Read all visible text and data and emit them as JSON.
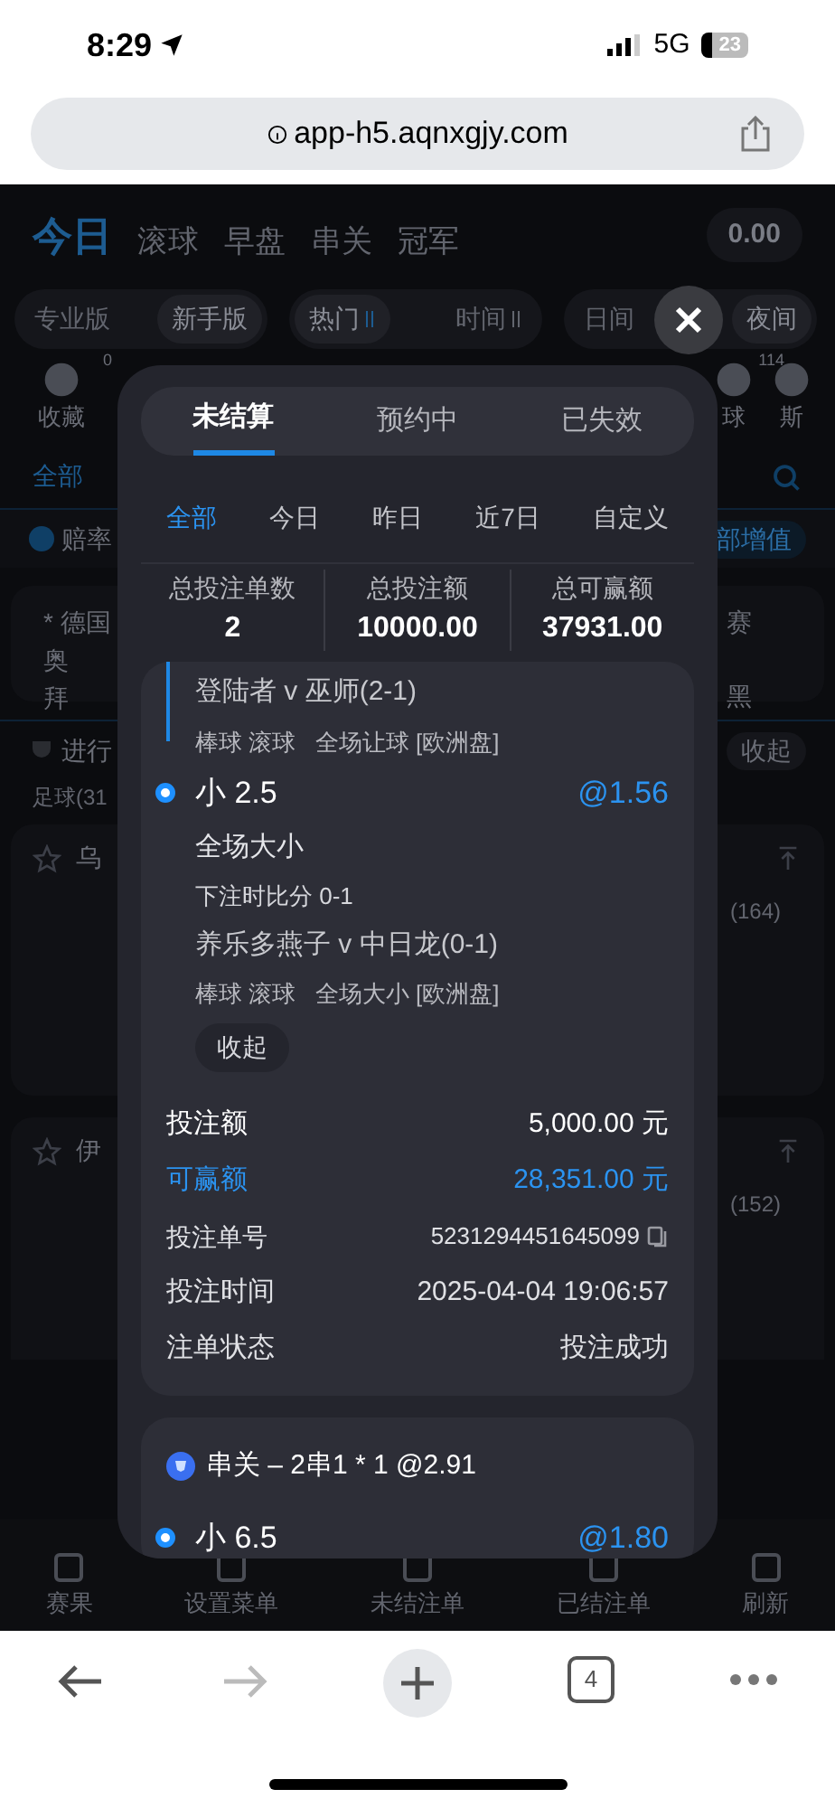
{
  "status_bar": {
    "time": "8:29",
    "network": "5G",
    "battery": "23"
  },
  "browser": {
    "url": "app-h5.aqnxgjy.com",
    "tab_count": "4"
  },
  "page": {
    "top_tabs": [
      {
        "label": "今日",
        "selected": true
      },
      {
        "label": "滚球",
        "selected": false
      },
      {
        "label": "早盘",
        "selected": false
      },
      {
        "label": "串关",
        "selected": false
      },
      {
        "label": "冠军",
        "selected": false
      }
    ],
    "balance": "0.00",
    "filter_groups": [
      [
        {
          "label": "专业版",
          "selected": false
        },
        {
          "label": "新手版",
          "selected": true
        }
      ],
      [
        {
          "label": "热门",
          "selected": true,
          "sort": true
        },
        {
          "label": "时间",
          "selected": false,
          "sort": true
        }
      ],
      [
        {
          "label": "日间",
          "selected": false
        },
        {
          "label": "夜间",
          "selected": true
        }
      ]
    ],
    "categories": [
      {
        "label": "收藏",
        "count": "0"
      },
      {
        "label": "球",
        "count": "114"
      },
      {
        "label": "斯"
      }
    ],
    "scope": "全部",
    "notice": "赔率",
    "notice_button": "部增值",
    "featured": {
      "league": "* 德国",
      "team_1": "奥",
      "team_2": "拜",
      "right_1": "赛",
      "right_2": "黑"
    },
    "section": {
      "title": "进行",
      "toggle": "收起",
      "sport": "足球(31"
    },
    "matches": [
      {
        "name": "乌",
        "count": "(164)"
      },
      {
        "name": "伊",
        "count": "(152)"
      }
    ],
    "bottom_nav": [
      "赛果",
      "设置菜单",
      "未结注单",
      "已结注单",
      "刷新"
    ]
  },
  "modal": {
    "tabs": [
      {
        "label": "未结算",
        "selected": true
      },
      {
        "label": "预约中",
        "selected": false
      },
      {
        "label": "已失效",
        "selected": false
      }
    ],
    "periods": [
      {
        "label": "全部",
        "selected": true
      },
      {
        "label": "今日",
        "selected": false
      },
      {
        "label": "昨日",
        "selected": false
      },
      {
        "label": "近7日",
        "selected": false
      },
      {
        "label": "自定义",
        "selected": false
      }
    ],
    "summary": [
      {
        "label": "总投注单数",
        "value": "2"
      },
      {
        "label": "总投注额",
        "value": "10000.00"
      },
      {
        "label": "总可赢额",
        "value": "37931.00"
      }
    ],
    "bets": [
      {
        "legs": [
          {
            "match": "登陆者 v 巫师(2-1)",
            "tags": "棒球 滚球   全场让球 [欧洲盘]"
          },
          {
            "selection": "小 2.5",
            "odds": "@1.56",
            "market": "全场大小",
            "score": "下注时比分 0-1",
            "match": "养乐多燕子 v 中日龙(0-1)",
            "tags": "棒球 滚球   全场大小 [欧洲盘]"
          }
        ],
        "collapse": "收起",
        "details": [
          {
            "kind": "amount",
            "label": "投注额",
            "value": "5,000.00 元"
          },
          {
            "kind": "win",
            "label": "可赢额",
            "value": "28,351.00 元"
          },
          {
            "kind": "copy",
            "label": "投注单号",
            "value": "5231294451645099"
          },
          {
            "kind": "plain",
            "label": "投注时间",
            "value": "2025-04-04 19:06:57"
          },
          {
            "kind": "plain",
            "label": "注单状态",
            "value": "投注成功"
          }
        ]
      },
      {
        "title": "串关 – 2串1 * 1 @2.91",
        "legs": [
          {
            "selection": "小 6.5",
            "odds": "@1.80"
          }
        ]
      }
    ]
  }
}
